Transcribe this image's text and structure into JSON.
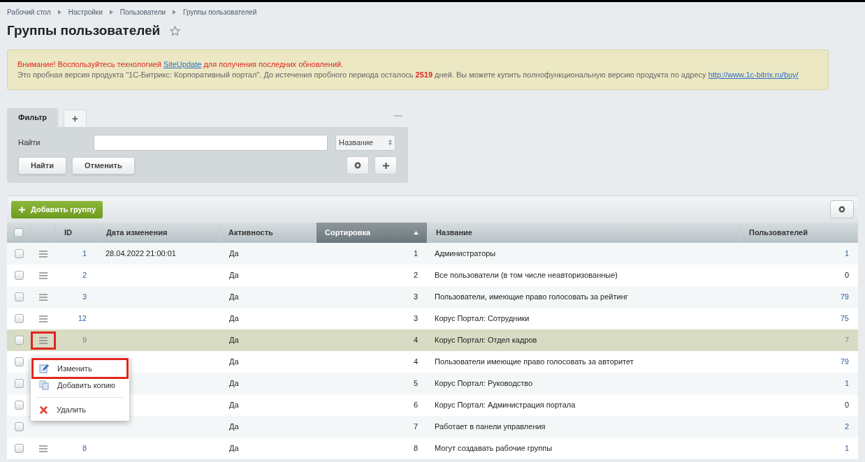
{
  "breadcrumbs": [
    "Рабочий стол",
    "Настройки",
    "Пользователи",
    "Группы пользователей"
  ],
  "title": "Группы пользователей",
  "notice": {
    "warning_before": "Внимание! Воспользуйтесь технологией",
    "warning_link": "SiteUpdate",
    "warning_after": "для получения последних обновлений.",
    "trial_before": "Это пробная версия продукта \"1С-Битрикс: Корпоративный портал\". До истечения пробного периода осталось",
    "days": "2519",
    "trial_after": "дней. Вы можете купить полнофункциональную версию продукта по адресу",
    "link": "http://www.1c-bitrix.ru/buy/"
  },
  "filter": {
    "tabs": [
      {
        "label": "Фильтр",
        "selected": true
      },
      {
        "label": "+",
        "selected": false
      }
    ],
    "find_label": "Найти",
    "field_select": "Название",
    "buttons": [
      "Найти",
      "Отменить"
    ]
  },
  "add_button": "Добавить группу",
  "table": {
    "select_all_checked": false,
    "columns": [
      {
        "label": "ID",
        "sorted": false
      },
      {
        "label": "Дата изменения",
        "sorted": false
      },
      {
        "label": "Активность",
        "sorted": false
      },
      {
        "label": "Сортировка",
        "sorted": true
      },
      {
        "label": "Название",
        "sorted": false
      },
      {
        "label": "Пользователей",
        "sorted": false
      }
    ],
    "rows": [
      {
        "id": "1",
        "date": "28.04.2022 21:00:01",
        "active": "Да",
        "sort": "1",
        "name": "Администраторы",
        "users": "1",
        "selected": false,
        "checked": false,
        "outlined": false
      },
      {
        "id": "2",
        "active": "Да",
        "sort": "2",
        "name": "Все пользователи (в том числе неавторизованные)",
        "users": "0",
        "selected": false,
        "checked": false,
        "outlined": false
      },
      {
        "id": "3",
        "active": "Да",
        "sort": "3",
        "name": "Пользователи, имеющие право голосовать за рейтинг",
        "users": "79",
        "selected": false,
        "checked": false,
        "outlined": false
      },
      {
        "id": "12",
        "active": "Да",
        "sort": "3",
        "name": "Корус Портал: Сотрудники",
        "users": "75",
        "selected": false,
        "checked": false,
        "outlined": false
      },
      {
        "id": "9",
        "active": "Да",
        "sort": "4",
        "name": "Корус Портал: Отдел кадров",
        "users": "7",
        "selected": true,
        "checked": false,
        "outlined": true
      },
      {
        "active": "Да",
        "sort": "4",
        "name": "Пользователи имеющие право голосовать за авторитет",
        "users": "79",
        "selected": false,
        "checked": false
      },
      {
        "active": "Да",
        "sort": "5",
        "name": "Корус Портал: Руководство",
        "users": "1",
        "selected": false,
        "checked": false
      },
      {
        "active": "Да",
        "sort": "6",
        "name": "Корус Портал: Администрация портала",
        "users": "0",
        "selected": false,
        "checked": false
      },
      {
        "active": "Да",
        "sort": "7",
        "name": "Работает в панели управления",
        "users": "2",
        "selected": false,
        "checked": false
      },
      {
        "id": "8",
        "active": "Да",
        "sort": "8",
        "name": "Могут создавать рабочие группы",
        "users": "1",
        "selected": false,
        "checked": false,
        "outlined": false
      }
    ]
  },
  "context_menu": {
    "items": [
      {
        "kind": "edit",
        "label": "Изменить",
        "outlined": true
      },
      {
        "kind": "copy",
        "label": "Добавить копию",
        "outlined": false
      },
      {
        "kind": "separator"
      },
      {
        "kind": "delete",
        "label": "Удалить",
        "outlined": false
      }
    ]
  }
}
